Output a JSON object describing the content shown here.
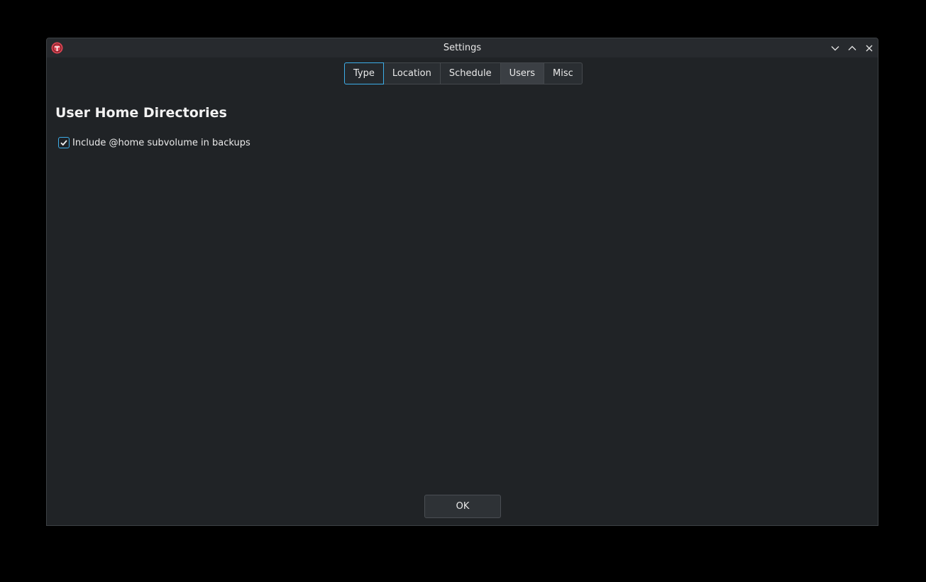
{
  "window": {
    "title": "Settings"
  },
  "window_controls": [
    "minimize-icon",
    "maximize-icon",
    "close-icon"
  ],
  "app_icon": "timeshift-icon",
  "tabs": [
    {
      "label": "Type",
      "state": "focused"
    },
    {
      "label": "Location",
      "state": "normal"
    },
    {
      "label": "Schedule",
      "state": "normal"
    },
    {
      "label": "Users",
      "state": "selected"
    },
    {
      "label": "Misc",
      "state": "normal"
    }
  ],
  "content": {
    "heading": "User Home Directories",
    "checkbox": {
      "label": "Include @home subvolume in backups",
      "checked": true
    }
  },
  "footer": {
    "ok_label": "OK"
  },
  "colors": {
    "background": "#202326",
    "accent": "#3daee9",
    "app_icon": "#da4453"
  }
}
